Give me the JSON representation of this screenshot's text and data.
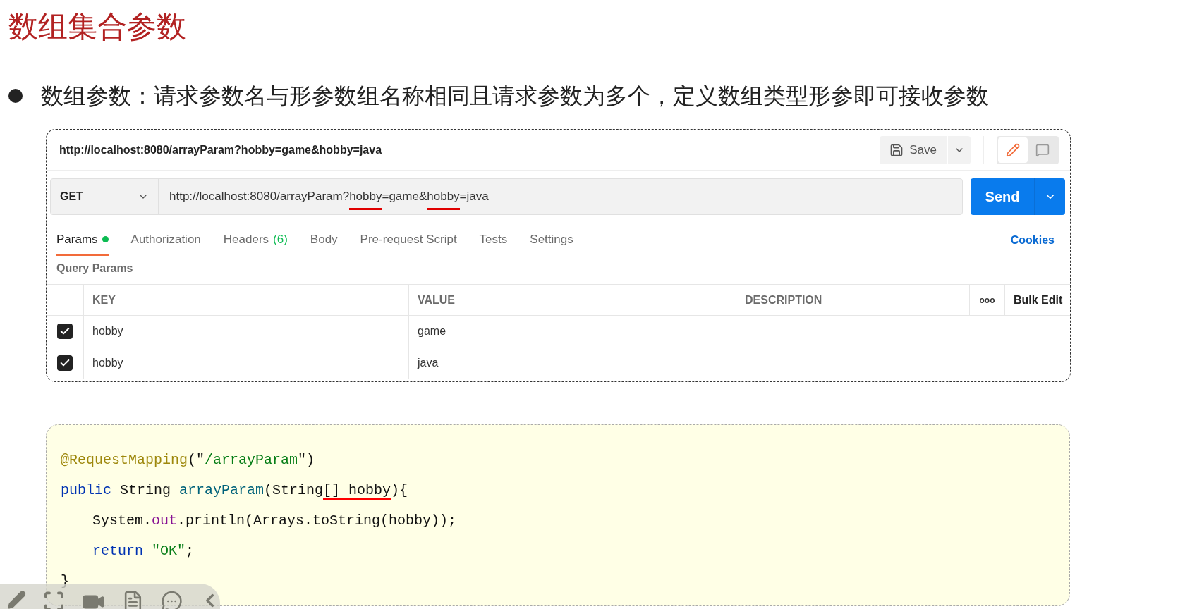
{
  "title": "数组集合参数",
  "bullet": "数组参数：请求参数名与形参数组名称相同且请求参数为多个，定义数组类型形参即可接收参数",
  "request": {
    "name": "http://localhost:8080/arrayParam?hobby=game&hobby=java",
    "save_label": "Save",
    "view_modes": [
      {
        "kind": "edit",
        "selected": true
      },
      {
        "kind": "comment",
        "selected": false
      }
    ],
    "method": "GET",
    "url_parts": [
      {
        "text": "http://localhost:8080/arrayParam?",
        "underlined": false
      },
      {
        "text": "hobby",
        "underlined": true
      },
      {
        "text": "=game&",
        "underlined": false
      },
      {
        "text": "hobby",
        "underlined": true
      },
      {
        "text": "=java",
        "underlined": false
      }
    ],
    "send_label": "Send",
    "tabs": [
      {
        "label": "Params",
        "indicator": true,
        "selected": true
      },
      {
        "label": "Authorization",
        "indicator": false,
        "selected": false
      },
      {
        "label": "Headers",
        "count": "(6)",
        "indicator": false,
        "selected": false
      },
      {
        "label": "Body",
        "indicator": false,
        "selected": false
      },
      {
        "label": "Pre-request Script",
        "indicator": false,
        "selected": false
      },
      {
        "label": "Tests",
        "indicator": false,
        "selected": false
      },
      {
        "label": "Settings",
        "indicator": false,
        "selected": false
      }
    ],
    "cookies_label": "Cookies",
    "section_label": "Query Params",
    "columns": [
      "KEY",
      "VALUE",
      "DESCRIPTION"
    ],
    "more_label": "ooo",
    "bulk_edit_label": "Bulk Edit",
    "rows": [
      {
        "checked": true,
        "key": "hobby",
        "value": "game"
      },
      {
        "checked": true,
        "key": "hobby",
        "value": "java"
      }
    ]
  },
  "code_lines": [
    [
      {
        "kind": "annotation",
        "text": "@RequestMapping"
      },
      {
        "kind": "plain",
        "text": "(\""
      },
      {
        "kind": "string",
        "text": "/arrayParam"
      },
      {
        "kind": "plain",
        "text": "\")"
      }
    ],
    [
      {
        "kind": "keyword",
        "text": "public"
      },
      {
        "kind": "plain",
        "text": " String "
      },
      {
        "kind": "method",
        "text": "arrayParam"
      },
      {
        "kind": "plain",
        "text": "(String"
      },
      {
        "kind": "underlined",
        "text": "[] hobby"
      },
      {
        "kind": "plain",
        "text": "){"
      }
    ],
    [
      {
        "kind": "indent"
      },
      {
        "kind": "plain",
        "text": "System."
      },
      {
        "kind": "field",
        "text": "out"
      },
      {
        "kind": "plain",
        "text": ".println(Arrays.toString(hobby));"
      }
    ],
    [
      {
        "kind": "indent"
      },
      {
        "kind": "keyword",
        "text": "return"
      },
      {
        "kind": "string",
        "text": " \"OK\""
      },
      {
        "kind": "plain",
        "text": ";"
      }
    ],
    [
      {
        "kind": "plain",
        "text": "}"
      }
    ]
  ]
}
